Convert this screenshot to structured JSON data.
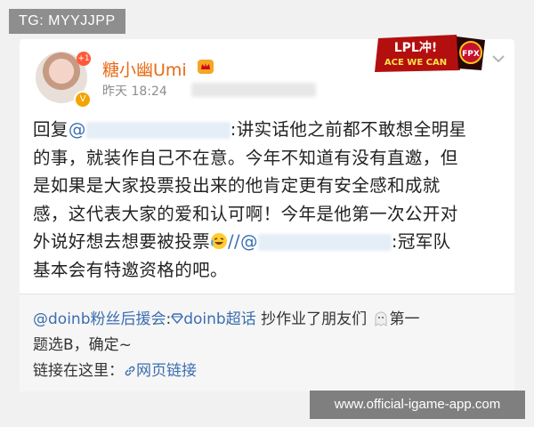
{
  "tag": "TG: MYYJJPP",
  "post": {
    "username": "糖小幽Umi",
    "timestamp": "昨天 18:24",
    "avatar_badge": "+1",
    "reply_prefix": "回复",
    "at_symbol": "@",
    "line1_after_mention": ":讲实话他之前都不敢想全明星",
    "line2": "的事，就装作自己不在意。今年不知道有没有直邀，但",
    "line3": "是如果是大家投票投出来的他肯定更有安全感和成就",
    "line4": "感，这代表大家的爱和认可啊！今年是他第一次公开对",
    "line5_before": "外说好想去想要被投票",
    "line5_mention_prefix": "//@",
    "line5_mention_visible": "",
    "line5_after": ":冠军队",
    "line6": "基本会有特邀资格的吧。",
    "banner_text_top": "LPL冲!",
    "banner_text_bottom": "ACE WE CAN",
    "banner_team": "FPX"
  },
  "repost": {
    "author": "@doinb粉丝后援会",
    "colon": ":",
    "topic": "doinb超话",
    "text_part1": " 抄作业了朋友们",
    "text_part2": "第一",
    "line2": "题选B，确定~",
    "link_label": "链接在这里：",
    "link_text": "网页链接"
  },
  "watermark": "www.official-igame-app.com",
  "colors": {
    "username": "#e86a14",
    "link_blue": "#3b6eb0",
    "badge_red": "#ff5a38"
  }
}
